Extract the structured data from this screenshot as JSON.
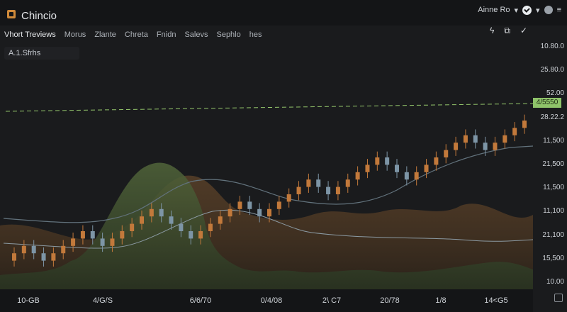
{
  "app": {
    "title": "Chincio"
  },
  "topbar": {
    "right_label": "Ainne Ro",
    "icons": [
      "star-icon",
      "user-icon",
      "check-circle-icon",
      "avatar-icon",
      "menu-icon"
    ]
  },
  "tabs": [
    {
      "label": "Vhort Treviews",
      "active": true
    },
    {
      "label": "Morus"
    },
    {
      "label": "Zlante"
    },
    {
      "label": "Chreta"
    },
    {
      "label": "Fnidn"
    },
    {
      "label": "Salevs"
    },
    {
      "label": "Sephlo"
    },
    {
      "label": "hes"
    }
  ],
  "toolbar": {
    "icons": [
      "flash-icon",
      "expand-icon",
      "check-icon"
    ]
  },
  "search_chip": {
    "label": "A.1.Sfrhs"
  },
  "price_tag": {
    "value": "4/5550"
  },
  "y_labels": [
    "10.80.0",
    "25.80.0",
    "52.00",
    "28.22.2",
    "11,500",
    "21,500",
    "11,500",
    "11,100",
    "21,100",
    "15,500",
    "10.00"
  ],
  "x_labels": [
    "10-GB",
    "4/G/S",
    "6/6/70",
    "0/4/08",
    "2\\ C7",
    "20/78",
    "1/8",
    "14<G5"
  ],
  "chart_data": {
    "type": "candlestick",
    "series": [
      {
        "name": "",
        "values": [
          2,
          3,
          2,
          1,
          2,
          3,
          4,
          5,
          4,
          3,
          4,
          5,
          6,
          7,
          8,
          7,
          6,
          5,
          4,
          5,
          6,
          7,
          8,
          9,
          8,
          7,
          8,
          9,
          10,
          11,
          12,
          11,
          10,
          11,
          12,
          13,
          14,
          15,
          14,
          13,
          12,
          13,
          14,
          15,
          16,
          17,
          18,
          17,
          16,
          17,
          18,
          19,
          20
        ]
      }
    ],
    "ylim": [
      0,
      25
    ]
  },
  "colors": {
    "bg": "#1a1b1d",
    "up": "#c2793b",
    "down": "#7d95a6",
    "area1": "#39492c",
    "area2": "#4d3a26",
    "price_line": "#94c66b"
  }
}
